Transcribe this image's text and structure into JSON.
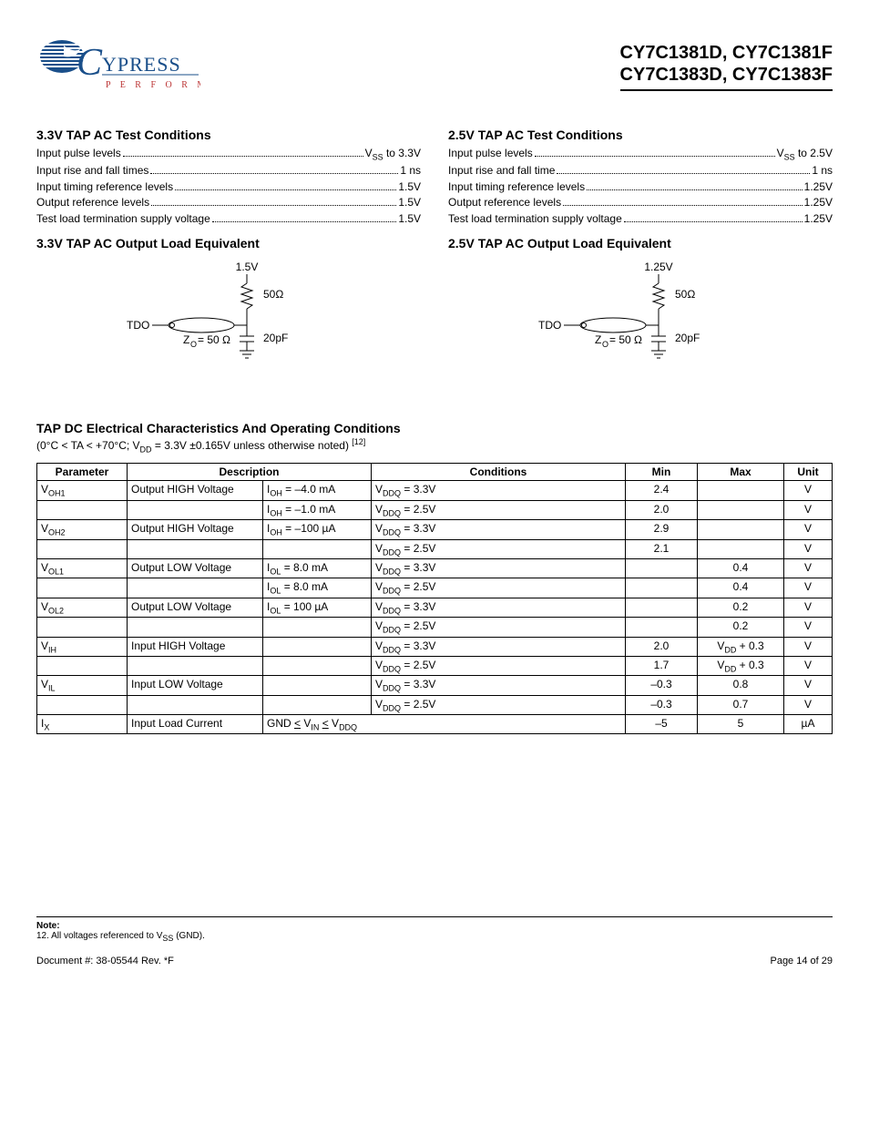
{
  "header": {
    "logo_word": "YPRESS",
    "logo_tag": "P  E  R  F  O  R  M",
    "parts_line1": "CY7C1381D, CY7C1381F",
    "parts_line2": "CY7C1383D, CY7C1383F"
  },
  "left": {
    "cond_title": "3.3V TAP AC Test Conditions",
    "rows": [
      {
        "label": "Input pulse levels",
        "value_html": "V<span class='sub'>SS</span> to 3.3V"
      },
      {
        "label": "Input rise and fall times",
        "value_html": "1 ns"
      },
      {
        "label": "Input timing reference levels",
        "value_html": "1.5V"
      },
      {
        "label": "Output reference levels",
        "value_html": "1.5V"
      },
      {
        "label": "Test load termination supply voltage",
        "value_html": "1.5V"
      }
    ],
    "load_title": "3.3V TAP AC Output Load Equivalent",
    "circuit": {
      "vtop": "1.5V",
      "r": "50Ω",
      "c": "20pF",
      "zo": "Z<tspan baseline-shift='sub' font-size='10'>O</tspan>= 50 Ω",
      "tdo": "TDO"
    }
  },
  "right": {
    "cond_title": "2.5V TAP AC Test Conditions",
    "rows": [
      {
        "label": "Input pulse levels",
        "value_html": "V<span class='sub'>SS</span> to 2.5V"
      },
      {
        "label": "Input rise and fall time",
        "value_html": "1 ns"
      },
      {
        "label": "Input timing reference levels",
        "value_html": "1.25V"
      },
      {
        "label": "Output reference levels",
        "value_html": "1.25V"
      },
      {
        "label": "Test load termination supply voltage",
        "value_html": "1.25V"
      }
    ],
    "load_title": "2.5V TAP AC Output Load Equivalent",
    "circuit": {
      "vtop": "1.25V",
      "r": "50Ω",
      "c": "20pF",
      "zo": "Z<tspan baseline-shift='sub' font-size='10'>O</tspan>= 50 Ω",
      "tdo": "TDO"
    }
  },
  "dc": {
    "title": "TAP DC Electrical Characteristics And Operating Conditions",
    "sub_html": "(0°C < TA < +70°C; V<span class='sub'>DD</span> = 3.3V ±0.165V unless otherwise noted) <span class='sup'>[12]</span>",
    "headers": [
      "Parameter",
      "Description",
      "Conditions",
      "Min",
      "Max",
      "Unit"
    ],
    "rows": [
      {
        "param": "V<span class='sub'>OH1</span>",
        "desc": "Output HIGH Voltage",
        "c1": "I<span class='sub'>OH</span> = –4.0 mA",
        "c2": "V<span class='sub'>DDQ</span> = 3.3V",
        "min": "2.4",
        "max": "",
        "unit": "V"
      },
      {
        "param": "",
        "desc": "",
        "c1": "I<span class='sub'>OH</span> = –1.0 mA",
        "c2": "V<span class='sub'>DDQ</span> = 2.5V",
        "min": "2.0",
        "max": "",
        "unit": "V"
      },
      {
        "param": "V<span class='sub'>OH2</span>",
        "desc": "Output HIGH Voltage",
        "c1": "I<span class='sub'>OH</span> = –100 µA",
        "c2": "V<span class='sub'>DDQ</span> = 3.3V",
        "min": "2.9",
        "max": "",
        "unit": "V"
      },
      {
        "param": "",
        "desc": "",
        "c1": "",
        "c2": "V<span class='sub'>DDQ</span> = 2.5V",
        "min": "2.1",
        "max": "",
        "unit": "V"
      },
      {
        "param": "V<span class='sub'>OL1</span>",
        "desc": "Output LOW Voltage",
        "c1": "I<span class='sub'>OL</span> = 8.0 mA",
        "c2": "V<span class='sub'>DDQ</span> = 3.3V",
        "min": "",
        "max": "0.4",
        "unit": "V"
      },
      {
        "param": "",
        "desc": "",
        "c1": "I<span class='sub'>OL</span> = 8.0 mA",
        "c2": "V<span class='sub'>DDQ</span> = 2.5V",
        "min": "",
        "max": "0.4",
        "unit": "V"
      },
      {
        "param": "V<span class='sub'>OL2</span>",
        "desc": "Output LOW Voltage",
        "c1": "I<span class='sub'>OL</span> = 100 µA",
        "c2": "V<span class='sub'>DDQ</span> = 3.3V",
        "min": "",
        "max": "0.2",
        "unit": "V"
      },
      {
        "param": "",
        "desc": "",
        "c1": "",
        "c2": "V<span class='sub'>DDQ</span> = 2.5V",
        "min": "",
        "max": "0.2",
        "unit": "V"
      },
      {
        "param": "V<span class='sub'>IH</span>",
        "desc": "Input HIGH Voltage",
        "c1": "",
        "c2": "V<span class='sub'>DDQ</span> = 3.3V",
        "min": "2.0",
        "max": "V<span class='sub'>DD</span> + 0.3",
        "unit": "V"
      },
      {
        "param": "",
        "desc": "",
        "c1": "",
        "c2": "V<span class='sub'>DDQ</span> = 2.5V",
        "min": "1.7",
        "max": "V<span class='sub'>DD</span> + 0.3",
        "unit": "V"
      },
      {
        "param": "V<span class='sub'>IL</span>",
        "desc": "Input LOW Voltage",
        "c1": "",
        "c2": "V<span class='sub'>DDQ</span> = 3.3V",
        "min": "–0.3",
        "max": "0.8",
        "unit": "V"
      },
      {
        "param": "",
        "desc": "",
        "c1": "",
        "c2": "V<span class='sub'>DDQ</span> = 2.5V",
        "min": "–0.3",
        "max": "0.7",
        "unit": "V"
      },
      {
        "param": "I<span class='sub'>X</span>",
        "desc": "Input Load Current",
        "c_full": "GND <u>&lt;</u> V<span class='sub'>IN</span> <u>&lt;</u> V<span class='sub'>DDQ</span>",
        "min": "–5",
        "max": "5",
        "unit": "µA"
      }
    ]
  },
  "footnote": {
    "label": "Note:",
    "text_html": "12. All voltages referenced to V<span class='sub'>SS</span> (GND)."
  },
  "footer": {
    "left": "Document #: 38-05544 Rev. *F",
    "right": "Page 14 of 29"
  }
}
